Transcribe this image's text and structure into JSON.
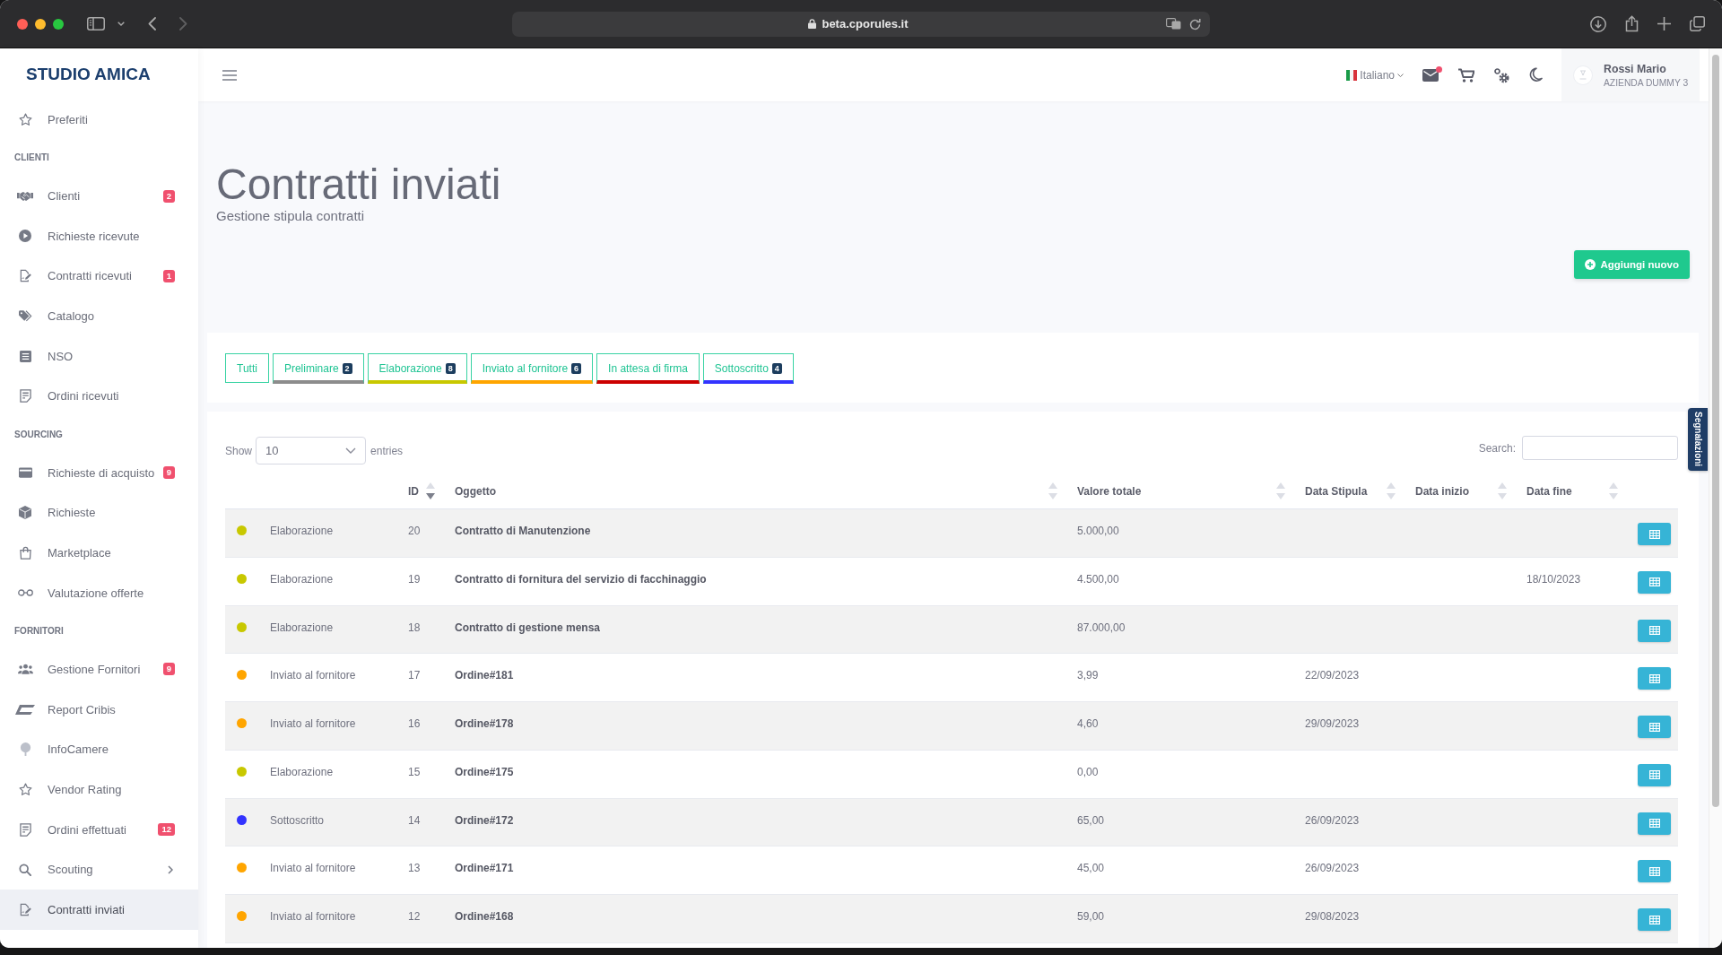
{
  "browser": {
    "url": "beta.cporules.it"
  },
  "sidebar": {
    "logo": "STUDIO AMICA",
    "sections": [
      {
        "items": [
          {
            "label": "Preferiti",
            "kind": "link",
            "selected": false
          }
        ]
      },
      {
        "heading": "CLIENTI",
        "items": [
          {
            "label": "Clienti",
            "badge": "2",
            "kind": "link",
            "selected": false
          },
          {
            "label": "Richieste ricevute",
            "kind": "link",
            "selected": false
          },
          {
            "label": "Contratti ricevuti",
            "badge": "1",
            "kind": "link",
            "selected": false
          },
          {
            "label": "Catalogo",
            "kind": "link",
            "selected": false
          },
          {
            "label": "NSO",
            "kind": "link",
            "selected": false
          },
          {
            "label": "Ordini ricevuti",
            "kind": "link",
            "selected": false
          }
        ]
      },
      {
        "heading": "SOURCING",
        "items": [
          {
            "label": "Richieste di acquisto",
            "badge": "9",
            "kind": "link",
            "selected": false
          },
          {
            "label": "Richieste",
            "kind": "link",
            "selected": false
          },
          {
            "label": "Marketplace",
            "kind": "link",
            "selected": false
          },
          {
            "label": "Valutazione offerte",
            "kind": "link",
            "selected": false
          }
        ]
      },
      {
        "heading": "FORNITORI",
        "items": [
          {
            "label": "Gestione Fornitori",
            "badge": "9",
            "kind": "link",
            "selected": false
          },
          {
            "label": "Report Cribis",
            "kind": "link",
            "selected": false
          },
          {
            "label": "InfoCamere",
            "kind": "link",
            "selected": false
          },
          {
            "label": "Vendor Rating",
            "kind": "link",
            "selected": false
          },
          {
            "label": "Ordini effettuati",
            "badge": "12",
            "kind": "link",
            "selected": false
          },
          {
            "label": "Scouting",
            "kind": "submenu",
            "expanded": false,
            "selected": false
          },
          {
            "label": "Contratti inviati",
            "kind": "link",
            "selected": true
          }
        ]
      }
    ]
  },
  "header": {
    "language": "Italiano",
    "mail_unread": true,
    "user": {
      "name": "Rossi Mario",
      "company": "AZIENDA DUMMY 3"
    }
  },
  "page": {
    "title": "Contratti inviati",
    "subtitle": "Gestione stipula contratti",
    "add_button": "Aggiungi nuovo"
  },
  "status_tabs": [
    {
      "label": "Tutti"
    },
    {
      "label": "Preliminare",
      "count": "2",
      "color": "#8c8c8c"
    },
    {
      "label": "Elaborazione",
      "count": "8",
      "color": "#c8c800"
    },
    {
      "label": "Inviato al fornitore",
      "count": "6",
      "color": "#ffa500"
    },
    {
      "label": "In attesa di firma",
      "color": "#cc0000"
    },
    {
      "label": "Sottoscritto",
      "count": "4",
      "color": "#3333ff"
    }
  ],
  "side_tab": "Segnalazioni",
  "table": {
    "length": {
      "before": "Show",
      "value": "10",
      "after": "entries"
    },
    "search_label": "Search:",
    "columns": [
      {
        "label": "ID",
        "sorted": true
      },
      {
        "label": "Oggetto",
        "sorted": false
      },
      {
        "label": "Valore totale",
        "sorted": false
      },
      {
        "label": "Data Stipula",
        "sorted": false
      },
      {
        "label": "Data inizio",
        "sorted": false
      },
      {
        "label": "Data fine",
        "sorted": false
      }
    ],
    "rows": [
      {
        "status": "Elaborazione",
        "color": "#c8c800",
        "id": "20",
        "subject": "Contratto di Manutenzione",
        "total_value": "5.000,00"
      },
      {
        "status": "Elaborazione",
        "color": "#c8c800",
        "id": "19",
        "subject": "Contratto di fornitura del servizio di facchinaggio",
        "total_value": "4.500,00",
        "end_date": "18/10/2023"
      },
      {
        "status": "Elaborazione",
        "color": "#c8c800",
        "id": "18",
        "subject": "Contratto di gestione mensa",
        "total_value": "87.000,00"
      },
      {
        "status": "Inviato al fornitore",
        "color": "#ffa500",
        "id": "17",
        "subject": "Ordine#181",
        "total_value": "3,99",
        "signing_date": "22/09/2023"
      },
      {
        "status": "Inviato al fornitore",
        "color": "#ffa500",
        "id": "16",
        "subject": "Ordine#178",
        "total_value": "4,60",
        "signing_date": "29/09/2023"
      },
      {
        "status": "Elaborazione",
        "color": "#c8c800",
        "id": "15",
        "subject": "Ordine#175",
        "total_value": "0,00"
      },
      {
        "status": "Sottoscritto",
        "color": "#3333ff",
        "id": "14",
        "subject": "Ordine#172",
        "total_value": "65,00",
        "signing_date": "26/09/2023"
      },
      {
        "status": "Inviato al fornitore",
        "color": "#ffa500",
        "id": "13",
        "subject": "Ordine#171",
        "total_value": "45,00",
        "signing_date": "26/09/2023"
      },
      {
        "status": "Inviato al fornitore",
        "color": "#ffa500",
        "id": "12",
        "subject": "Ordine#168",
        "total_value": "59,00",
        "signing_date": "29/08/2023"
      }
    ]
  }
}
